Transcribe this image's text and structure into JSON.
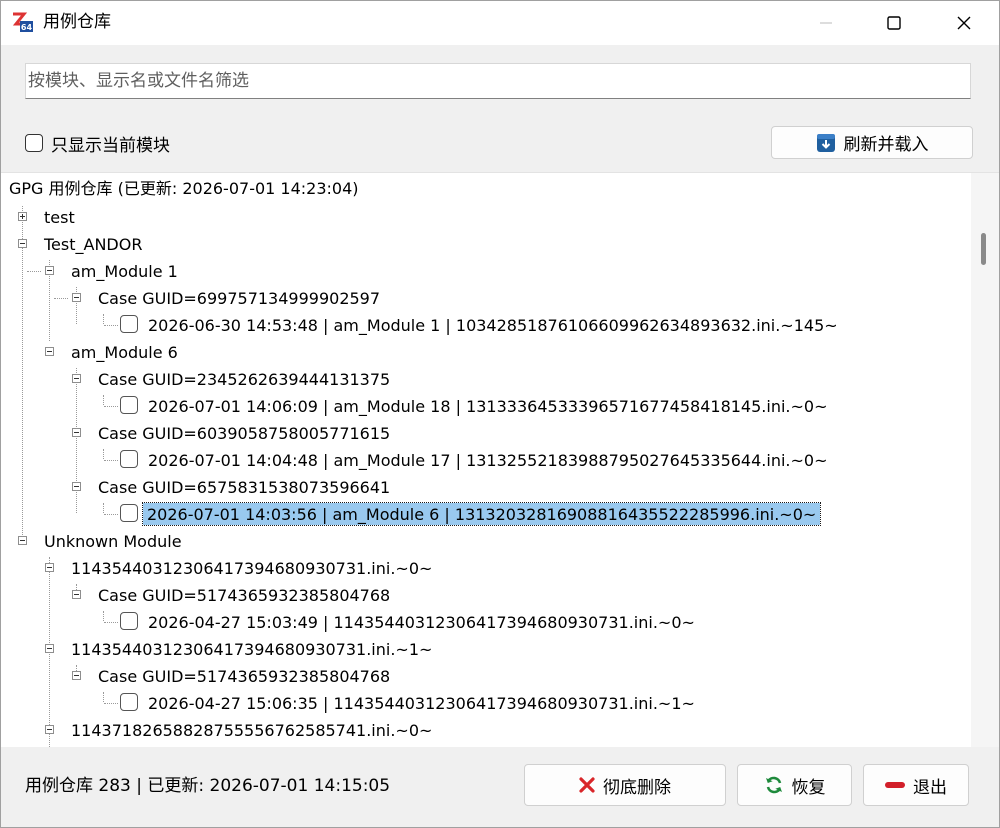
{
  "window": {
    "title": "用例仓库",
    "icon_text": "64"
  },
  "filter": {
    "placeholder": "按模块、显示名或文件名筛选",
    "value": ""
  },
  "options": {
    "only_current_module_label": "只显示当前模块",
    "refresh_button_label": "刷新并载入"
  },
  "tree": {
    "root_label": "GPG 用例仓库 (已更新: 2026-07-01 14:23:04)",
    "rows": [
      {
        "text": "test"
      },
      {
        "text": "Test_ANDOR"
      },
      {
        "text": "am_Module 1"
      },
      {
        "text": "Case GUID=699757134999902597"
      },
      {
        "text": "2026-06-30 14:53:48 | am_Module 1 | 1034285187610660996263489​3632.ini.~145~"
      },
      {
        "text": "am_Module 6"
      },
      {
        "text": "Case GUID=2345262639444131375"
      },
      {
        "text": "2026-07-01 14:06:09 | am_Module 18 | 131333645333965716774584​18145.ini.~0~"
      },
      {
        "text": "Case GUID=6039058758005771615"
      },
      {
        "text": "2026-07-01 14:04:48 | am_Module 17 | 131325521839887950276453​35644.ini.~0~"
      },
      {
        "text": "Case GUID=6575831538073596641"
      },
      {
        "text": "2026-07-01 14:03:56 | am_Module 6 | 131320328169088164355222​85996.ini.~0~"
      },
      {
        "text": "Unknown Module"
      },
      {
        "text": "114354403123064173946809​30731.ini.~0~"
      },
      {
        "text": "Case GUID=5174365932385804768"
      },
      {
        "text": "2026-04-27 15:03:49 | 114354403123064173946809​30731.ini.~0~"
      },
      {
        "text": "114354403123064173946809​30731.ini.~1~"
      },
      {
        "text": "Case GUID=5174365932385804768"
      },
      {
        "text": "2026-04-27 15:06:35 | 114354403123064173946809​30731.ini.~1~"
      },
      {
        "text": "114371826588287555567625​85741.ini.~0~"
      }
    ]
  },
  "footer": {
    "status": "用例仓库 283 | 已更新: 2026-07-01 14:15:05",
    "delete_label": "彻底删除",
    "restore_label": "恢复",
    "exit_label": "退出"
  },
  "colors": {
    "selection": "#99c9ef",
    "delete_icon": "#d9262a",
    "restore_icon": "#1e8a3c",
    "exit_icon": "#d21f2a",
    "refresh_icon": "#1f5f9f"
  }
}
